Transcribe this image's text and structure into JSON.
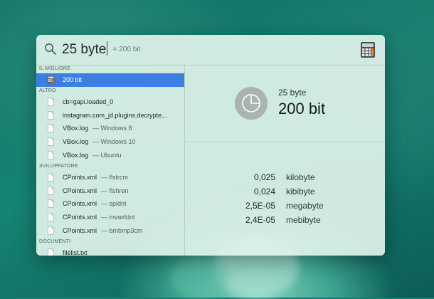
{
  "search": {
    "query": "25 byte",
    "inline_result": "= 200 bit"
  },
  "sections": {
    "top_hit": "IL MIGLIORE",
    "other": "ALTRO",
    "developer": "SVILUPPATORE",
    "documents": "DOCUMENTI"
  },
  "results": {
    "top_hit": {
      "label": "200 bit"
    },
    "other": [
      {
        "label": "cb=gapi.loaded_0",
        "sub": ""
      },
      {
        "label": "instagram.com_jd.plugins.decrypte...",
        "sub": ""
      },
      {
        "label": "VBox.log",
        "sub": "— Windows 8"
      },
      {
        "label": "VBox.log",
        "sub": "— Windows 10"
      },
      {
        "label": "VBox.log",
        "sub": "— Ubuntu"
      }
    ],
    "developer": [
      {
        "label": "CPoints.xml",
        "sub": "— flstrcm"
      },
      {
        "label": "CPoints.xml",
        "sub": "— flshren"
      },
      {
        "label": "CPoints.xml",
        "sub": "— spldnt"
      },
      {
        "label": "CPoints.xml",
        "sub": "— mvwrldnt"
      },
      {
        "label": "CPoints.xml",
        "sub": "— bmbmp3cm"
      }
    ],
    "documents": [
      {
        "label": "filelist.txt",
        "sub": ""
      }
    ]
  },
  "preview": {
    "query": "25 byte",
    "result": "200 bit",
    "conversions": [
      {
        "value": "0,025",
        "unit": "kilobyte"
      },
      {
        "value": "0,024",
        "unit": "kibibyte"
      },
      {
        "value": "2,5E-05",
        "unit": "megabyte"
      },
      {
        "value": "2,4E-05",
        "unit": "mebibyte"
      }
    ]
  },
  "icons": {
    "search": "search-icon",
    "calculator": "calculator-icon",
    "document": "document-icon",
    "pie_chart": "pie-chart-icon"
  },
  "colors": {
    "selection": "#3d7fe0",
    "panel": "#def2ea"
  }
}
